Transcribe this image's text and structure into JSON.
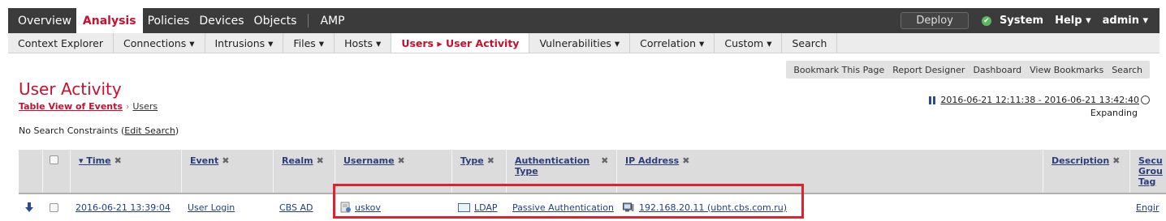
{
  "topnav": {
    "items": [
      "Overview",
      "Analysis",
      "Policies",
      "Devices",
      "Objects",
      "AMP"
    ],
    "active": "Analysis",
    "deploy": "Deploy",
    "system": "System",
    "help": "Help ▾",
    "user": "admin ▾"
  },
  "subnav": {
    "items": [
      "Context Explorer",
      "Connections ▾",
      "Intrusions ▾",
      "Files ▾",
      "Hosts ▾",
      "Users ▸ User Activity",
      "Vulnerabilities ▾",
      "Correlation ▾",
      "Custom ▾",
      "Search"
    ]
  },
  "toolbar": {
    "items": [
      "Bookmark This Page",
      "Report Designer",
      "Dashboard",
      "View Bookmarks",
      "Search"
    ]
  },
  "page": {
    "title": "User Activity",
    "breadcrumb_1": "Table View of Events",
    "breadcrumb_arrow": "›",
    "breadcrumb_2": "Users",
    "time_range": "2016-06-21 12:11:38 - 2016-06-21 13:42:40",
    "expanding": "Expanding",
    "constraints_prefix": "No Search Constraints (",
    "constraints_link": "Edit Search",
    "constraints_suffix": ")"
  },
  "table": {
    "headers": {
      "time": "▾ Time",
      "event": "Event",
      "realm": "Realm",
      "username": "Username",
      "type": "Type",
      "auth1": "Authentication",
      "auth2": "Type",
      "ip": "IP Address",
      "description": "Description",
      "sec1": "Secu",
      "sec2": "Grou",
      "sec3": "Tag",
      "close": "✖"
    },
    "row": {
      "time": "2016-06-21 13:39:04",
      "event": "User Login",
      "realm": "CBS AD",
      "username": "uskov",
      "type": "LDAP",
      "auth": "Passive Authentication",
      "ip": "192.168.20.11 (ubnt.cbs.com.ru)",
      "sec": "Engir"
    }
  },
  "colors": {
    "accent": "#c8102e",
    "nav_bg": "#3b3b3b",
    "link": "#1f3f80",
    "highlight": "#e0222e"
  }
}
